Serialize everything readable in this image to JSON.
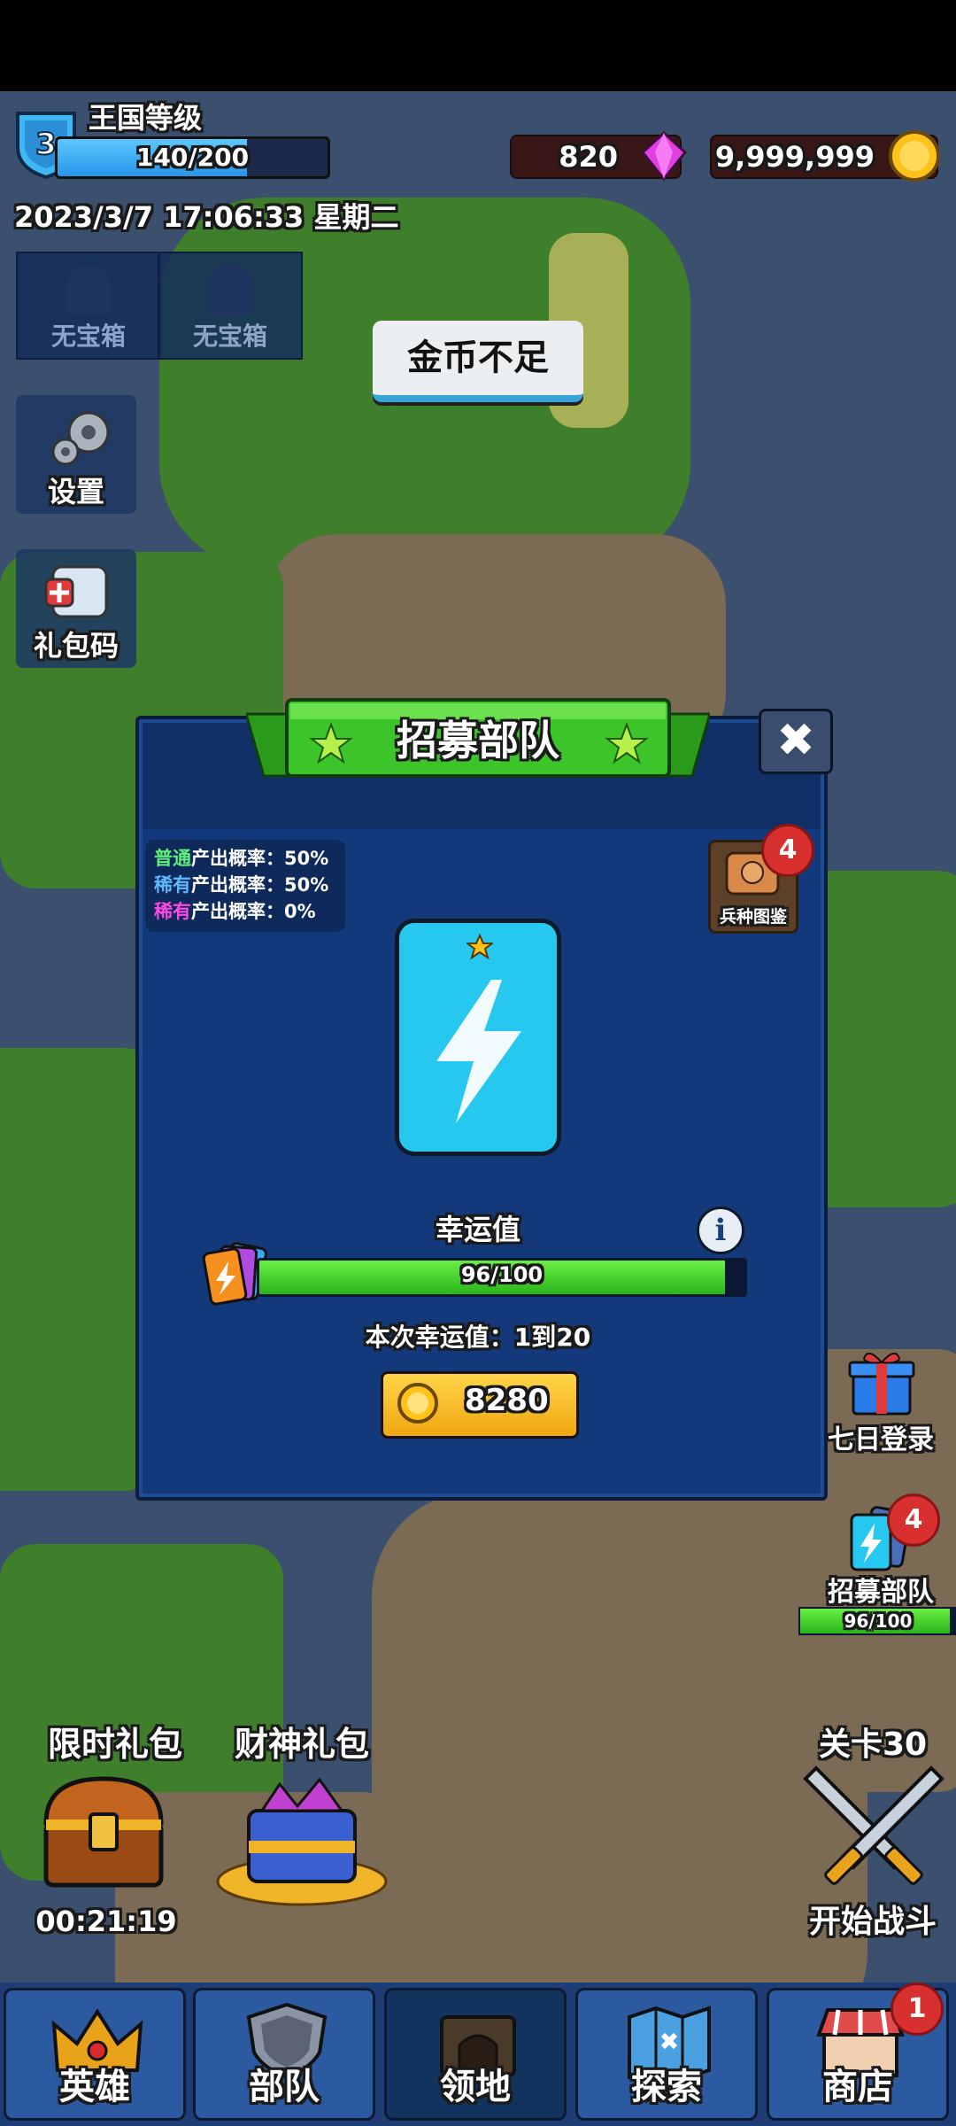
{
  "hud": {
    "level": "3",
    "kingdom_title": "王国等级",
    "xp_text": "140/200",
    "xp_fraction": 0.7,
    "gems": "820",
    "coins": "9,999,999",
    "datetime": "2023/3/7 17:06:33 星期二"
  },
  "chests": [
    {
      "label": "无宝箱"
    },
    {
      "label": "无宝箱"
    }
  ],
  "side_buttons": {
    "settings": "设置",
    "gift_code": "礼包码"
  },
  "toast": "金币不足",
  "dialog": {
    "title": "招募部队",
    "close_symbol": "✖",
    "rates": [
      {
        "tier": "普通",
        "tier_color": "#5ef07a",
        "text": "产出概率：50%"
      },
      {
        "tier": "稀有",
        "tier_color": "#5fb8ff",
        "text": "产出概率：50%"
      },
      {
        "tier": "稀有",
        "tier_color": "#ff48e0",
        "text": "产出概率：0%"
      }
    ],
    "codex_label": "兵种图鉴",
    "codex_badge": "4",
    "luck_label": "幸运值",
    "info_symbol": "i",
    "luck_text": "96/100",
    "luck_fraction": 0.96,
    "luck_range": "本次幸运值：1到20",
    "buy_price": "8280"
  },
  "right_panel": {
    "seven_day": "七日登录",
    "recruit": "招募部队",
    "recruit_badge": "4",
    "recruit_progress": "96/100",
    "stage": "关卡30",
    "start_battle": "开始战斗"
  },
  "left_packs": {
    "limited": "限时礼包",
    "timer": "00:21:19",
    "wealth": "财神礼包"
  },
  "nav": {
    "tabs": [
      "英雄",
      "部队",
      "领地",
      "探索",
      "商店"
    ],
    "active_index": 2,
    "shop_badge": "1"
  },
  "colors": {
    "dialog_bg": "#13397a",
    "banner_green": "#3cc42a",
    "card_cyan": "#27c8f0",
    "coin_gold": "#ffc21a",
    "gem_pink": "#e040e0"
  }
}
